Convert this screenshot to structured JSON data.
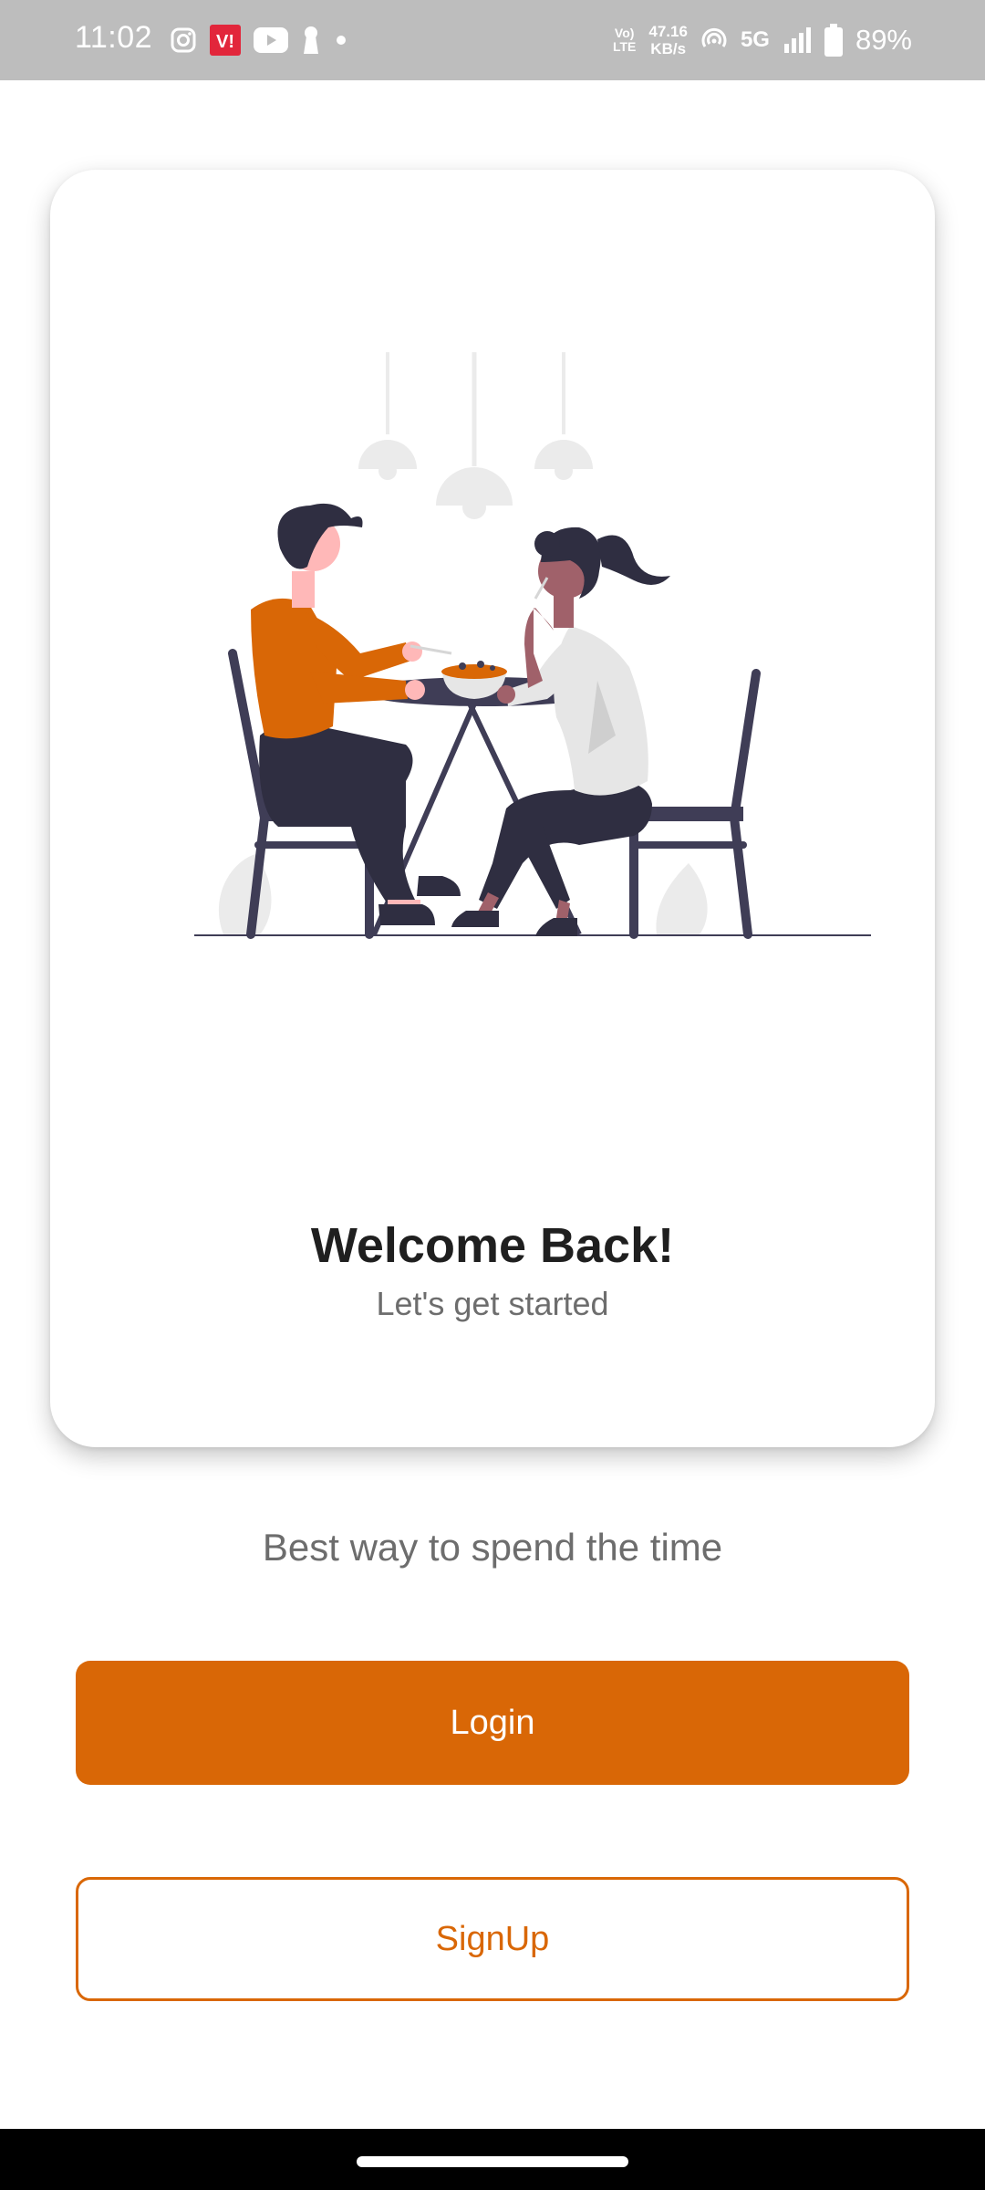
{
  "status_bar": {
    "time": "11:02",
    "left_icons": [
      "instagram-icon",
      "vi-app-icon",
      "youtube-icon",
      "keyhole-icon",
      "dot-icon"
    ],
    "volte_top": "Vo)",
    "volte_bottom": "LTE",
    "speed_value": "47.16",
    "speed_unit": "KB/s",
    "network": "5G",
    "battery": "89%"
  },
  "card": {
    "title": "Welcome Back!",
    "subtitle": "Let's get started",
    "illustration": "two-people-dining-illustration"
  },
  "tagline": "Best way to spend the time",
  "buttons": {
    "login": "Login",
    "signup": "SignUp"
  },
  "colors": {
    "accent": "#d96706",
    "status_bar": "#bdbdbd",
    "dark_figure": "#3f3d56",
    "text_dark": "#1f1f1f",
    "text_muted": "#6d6d6d"
  }
}
